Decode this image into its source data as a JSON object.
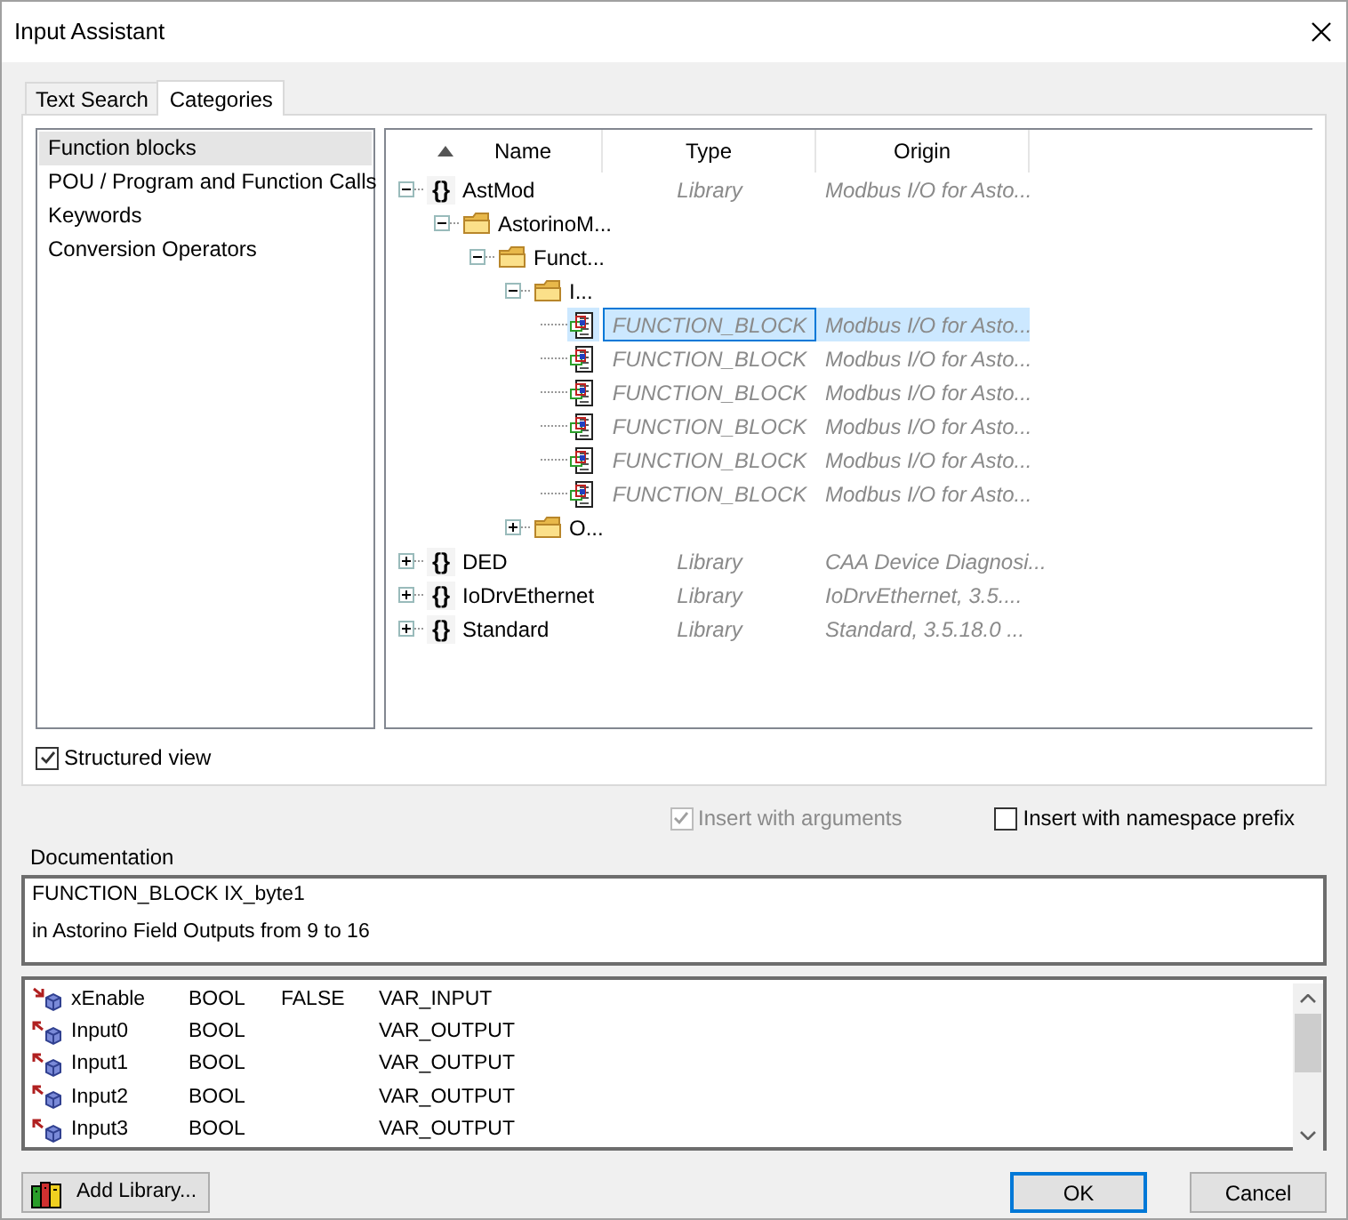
{
  "window": {
    "title": "Input Assistant"
  },
  "tabs": [
    {
      "label": "Text Search",
      "selected": false
    },
    {
      "label": "Categories",
      "selected": true
    }
  ],
  "categories": [
    {
      "label": "Function blocks",
      "selected": true
    },
    {
      "label": "POU / Program and Function Calls",
      "selected": false
    },
    {
      "label": "Keywords",
      "selected": false
    },
    {
      "label": "Conversion Operators",
      "selected": false
    }
  ],
  "tree": {
    "columns": [
      "Name",
      "Type",
      "Origin"
    ],
    "nodes": [
      {
        "kind": "library",
        "glyph": "{}",
        "name": "AstMod",
        "type": "Library",
        "origin": "Modbus I/O for Asto...",
        "expanded": true,
        "selected": false,
        "children": [
          {
            "kind": "folder",
            "name": "AstorinoM...",
            "expanded": true,
            "selected": false,
            "children": [
              {
                "kind": "folder",
                "name": "Funct...",
                "expanded": true,
                "selected": false,
                "children": [
                  {
                    "kind": "folder",
                    "name": "I...",
                    "expanded": true,
                    "selected": false,
                    "children": [
                      {
                        "kind": "function_block",
                        "type": "FUNCTION_BLOCK",
                        "origin": "Modbus I/O for Asto...",
                        "selected": true
                      },
                      {
                        "kind": "function_block",
                        "type": "FUNCTION_BLOCK",
                        "origin": "Modbus I/O for Asto...",
                        "selected": false
                      },
                      {
                        "kind": "function_block",
                        "type": "FUNCTION_BLOCK",
                        "origin": "Modbus I/O for Asto...",
                        "selected": false
                      },
                      {
                        "kind": "function_block",
                        "type": "FUNCTION_BLOCK",
                        "origin": "Modbus I/O for Asto...",
                        "selected": false
                      },
                      {
                        "kind": "function_block",
                        "type": "FUNCTION_BLOCK",
                        "origin": "Modbus I/O for Asto...",
                        "selected": false
                      },
                      {
                        "kind": "function_block",
                        "type": "FUNCTION_BLOCK",
                        "origin": "Modbus I/O for Asto...",
                        "selected": false
                      }
                    ]
                  },
                  {
                    "kind": "folder",
                    "name": "O...",
                    "expanded": false,
                    "selected": false
                  }
                ]
              }
            ]
          }
        ]
      },
      {
        "kind": "library",
        "glyph": "{}",
        "name": "DED",
        "type": "Library",
        "origin": "CAA Device Diagnosi...",
        "expanded": false,
        "selected": false
      },
      {
        "kind": "library",
        "glyph": "{}",
        "name": "IoDrvEthernet",
        "type": "Library",
        "origin": "IoDrvEthernet, 3.5....",
        "expanded": false,
        "selected": false
      },
      {
        "kind": "library",
        "glyph": "{}",
        "name": "Standard",
        "type": "Library",
        "origin": "Standard, 3.5.18.0 ...",
        "expanded": false,
        "selected": false
      }
    ]
  },
  "structured_view": {
    "label": "Structured view",
    "checked": true
  },
  "insert_with_arguments": {
    "label": "Insert with arguments",
    "checked": true,
    "disabled": true
  },
  "insert_with_namespace_prefix": {
    "label": "Insert with namespace prefix",
    "checked": false,
    "disabled": false
  },
  "documentation": {
    "label": "Documentation",
    "lines": [
      "FUNCTION_BLOCK IX_byte1",
      "in Astorino Field Outputs from 9 to 16"
    ]
  },
  "parameters": [
    {
      "kind": "input",
      "name": "xEnable",
      "type": "BOOL",
      "initial": "FALSE",
      "scope": "VAR_INPUT"
    },
    {
      "kind": "output",
      "name": "Input0",
      "type": "BOOL",
      "scope": "VAR_OUTPUT"
    },
    {
      "kind": "output",
      "name": "Input1",
      "type": "BOOL",
      "scope": "VAR_OUTPUT"
    },
    {
      "kind": "output",
      "name": "Input2",
      "type": "BOOL",
      "scope": "VAR_OUTPUT"
    },
    {
      "kind": "output",
      "name": "Input3",
      "type": "BOOL",
      "scope": "VAR_OUTPUT"
    }
  ],
  "buttons": {
    "add_library": "Add Library...",
    "ok": "OK",
    "cancel": "Cancel"
  }
}
